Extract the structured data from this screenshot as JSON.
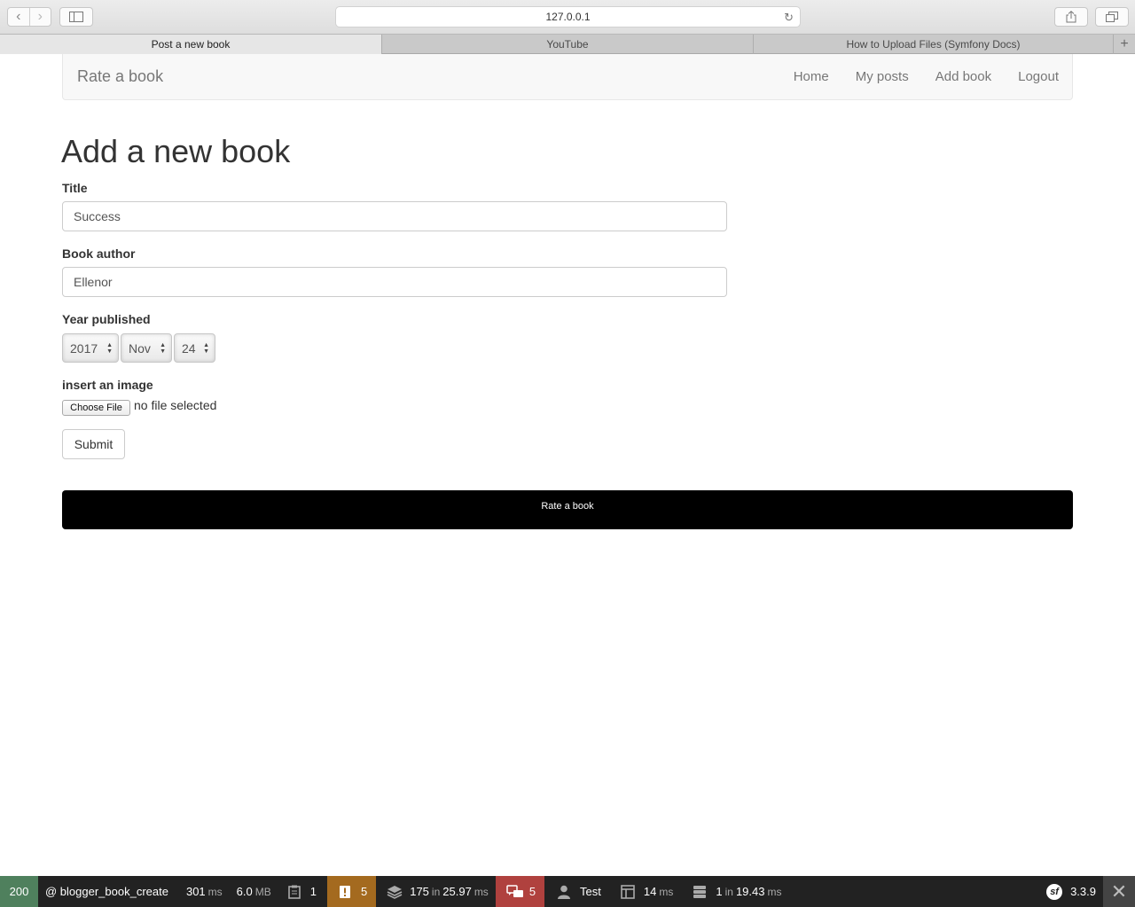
{
  "browser": {
    "url": "127.0.0.1",
    "tabs": [
      {
        "label": "Post a new book",
        "active": true
      },
      {
        "label": "YouTube",
        "active": false
      },
      {
        "label": "How to Upload Files (Symfony Docs)",
        "active": false
      }
    ],
    "new_tab_label": "+"
  },
  "navbar": {
    "brand": "Rate a book",
    "links": [
      "Home",
      "My posts",
      "Add book",
      "Logout"
    ]
  },
  "form": {
    "heading": "Add a new book",
    "title_label": "Title",
    "title_value": "Success",
    "author_label": "Book author",
    "author_value": "Ellenor",
    "year_label": "Year published",
    "year": "2017",
    "month": "Nov",
    "day": "24",
    "image_label": "insert an image",
    "choose_file": "Choose File",
    "no_file": "no file selected",
    "submit": "Submit"
  },
  "footer": {
    "text": "Rate a book"
  },
  "debug_toolbar": {
    "status": "200",
    "route": "@ blogger_book_create",
    "time_value": "301",
    "time_unit": "ms",
    "memory_value": "6.0",
    "memory_unit": "MB",
    "logs_count": "1",
    "warnings_count": "5",
    "cache_count": "175",
    "cache_in": "in",
    "cache_time": "25.97",
    "cache_unit": "ms",
    "translation_count": "5",
    "user": "Test",
    "twig_time": "14",
    "twig_unit": "ms",
    "db_count": "1",
    "db_in": "in",
    "db_time": "19.43",
    "db_unit": "ms",
    "version": "3.3.9",
    "colors": {
      "status": "#4f805d",
      "warning": "#a46a1f",
      "error": "#b0413e",
      "bar": "#222222"
    }
  }
}
